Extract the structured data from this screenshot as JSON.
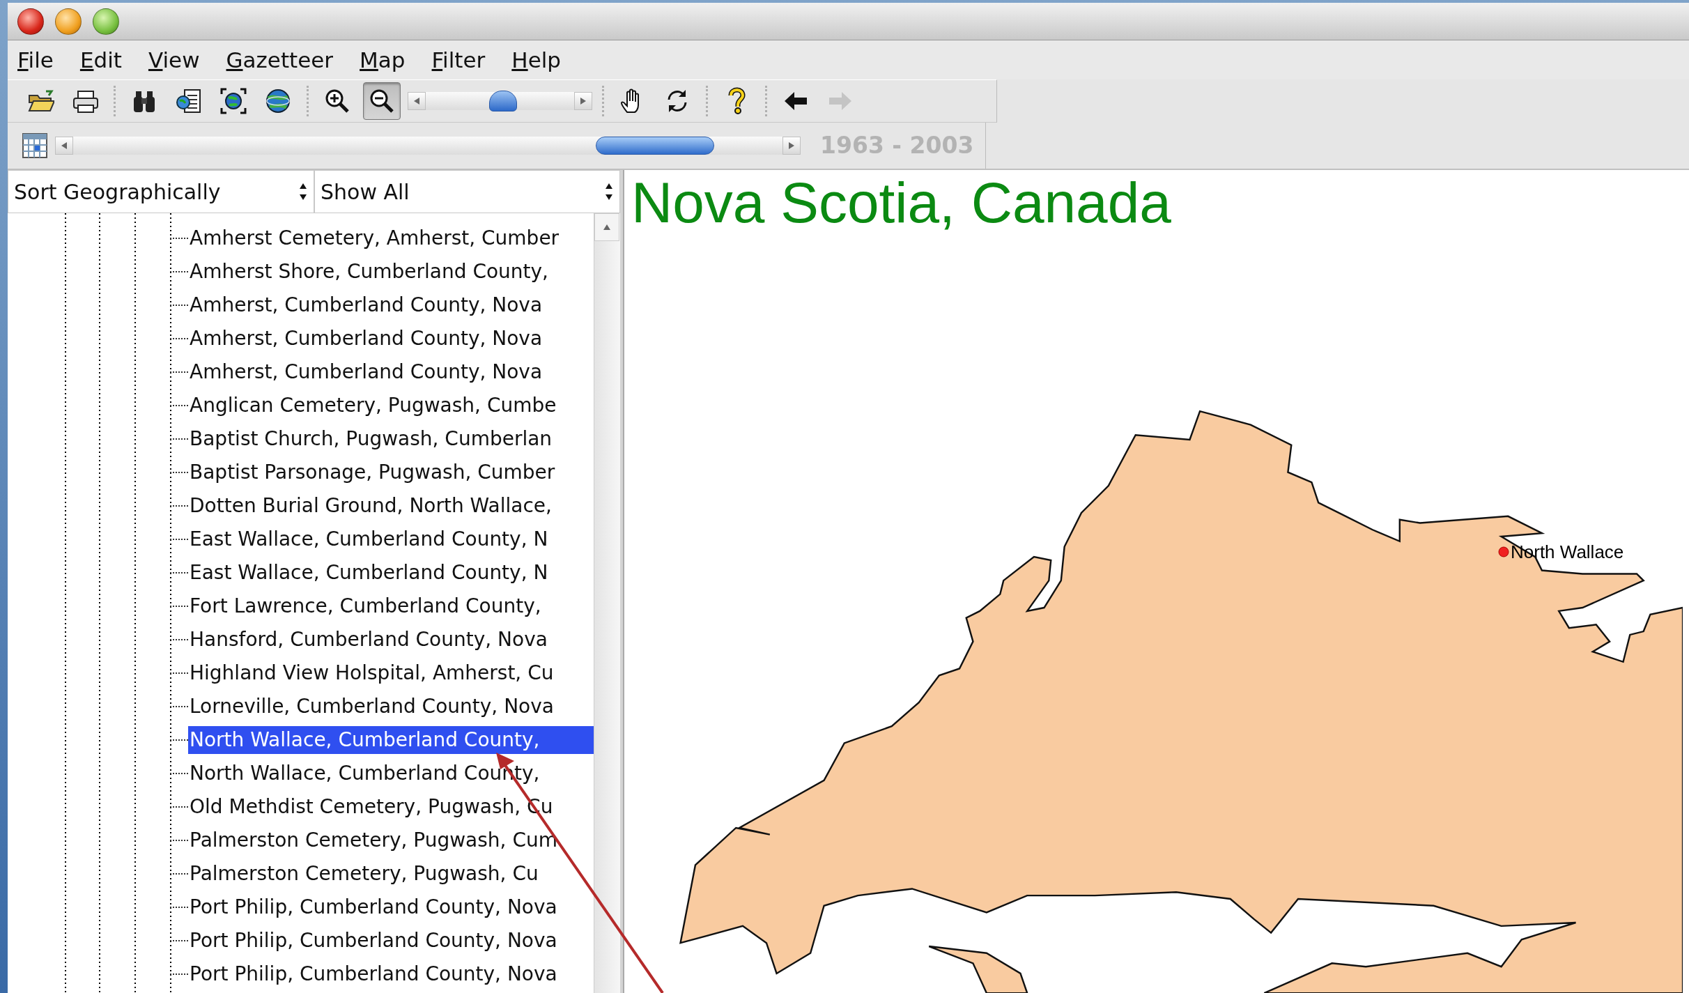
{
  "window": {
    "controls": [
      {
        "kind": "close"
      },
      {
        "kind": "minimize"
      },
      {
        "kind": "zoom"
      }
    ]
  },
  "menu": [
    "File",
    "Edit",
    "View",
    "Gazetteer",
    "Map",
    "Filter",
    "Help"
  ],
  "toolbar": [
    {
      "kind": "open",
      "pressed": false,
      "disabled": false
    },
    {
      "kind": "print",
      "pressed": false,
      "disabled": false
    },
    {
      "kind": "separator"
    },
    {
      "kind": "find",
      "pressed": false,
      "disabled": false
    },
    {
      "kind": "document",
      "pressed": false,
      "disabled": false
    },
    {
      "kind": "extent",
      "pressed": false,
      "disabled": false
    },
    {
      "kind": "globe",
      "pressed": false,
      "disabled": false
    },
    {
      "kind": "separator"
    },
    {
      "kind": "zoom-in",
      "pressed": false,
      "disabled": false
    },
    {
      "kind": "zoom-out",
      "pressed": true,
      "disabled": false
    },
    {
      "kind": "slider",
      "level": 0.52
    },
    {
      "kind": "separator"
    },
    {
      "kind": "pan",
      "pressed": false,
      "disabled": false
    },
    {
      "kind": "refresh",
      "pressed": false,
      "disabled": false
    },
    {
      "kind": "separator"
    },
    {
      "kind": "help",
      "pressed": false,
      "disabled": false
    },
    {
      "kind": "separator"
    },
    {
      "kind": "back",
      "pressed": false,
      "disabled": false
    },
    {
      "kind": "forward",
      "pressed": false,
      "disabled": true
    }
  ],
  "time_bar": {
    "level": 0.82,
    "range": "1963 - 2003"
  },
  "sort_select": {
    "value": "Sort Geographically"
  },
  "filter_select": {
    "value": "Show All"
  },
  "tree": {
    "items": [
      {
        "label": "Amherst Cemetery, Amherst, Cumber",
        "selected": false
      },
      {
        "label": "Amherst Shore, Cumberland County,",
        "selected": false
      },
      {
        "label": "Amherst, Cumberland County, Nova",
        "selected": false
      },
      {
        "label": "Amherst, Cumberland County, Nova",
        "selected": false
      },
      {
        "label": "Amherst, Cumberland County, Nova",
        "selected": false
      },
      {
        "label": "Anglican Cemetery, Pugwash, Cumbe",
        "selected": false
      },
      {
        "label": "Baptist Church, Pugwash, Cumberlan",
        "selected": false
      },
      {
        "label": "Baptist Parsonage, Pugwash, Cumber",
        "selected": false
      },
      {
        "label": "Dotten Burial Ground, North Wallace,",
        "selected": false
      },
      {
        "label": "East Wallace, Cumberland County, N",
        "selected": false
      },
      {
        "label": "East Wallace, Cumberland County, N",
        "selected": false
      },
      {
        "label": "Fort Lawrence, Cumberland County,",
        "selected": false
      },
      {
        "label": "Hansford, Cumberland County, Nova",
        "selected": false
      },
      {
        "label": "Highland View Holspital, Amherst, Cu",
        "selected": false
      },
      {
        "label": "Lorneville, Cumberland County, Nova",
        "selected": false
      },
      {
        "label": "North Wallace, Cumberland County,",
        "selected": true
      },
      {
        "label": "North Wallace, Cumberland County,",
        "selected": false
      },
      {
        "label": "Old Methdist Cemetery, Pugwash, Cu",
        "selected": false
      },
      {
        "label": "Palmerston Cemetery, Pugwash, Cum",
        "selected": false
      },
      {
        "label": "Palmerston Cemetery, Pugwash, Cu",
        "selected": false
      },
      {
        "label": "Port Philip, Cumberland County, Nova",
        "selected": false
      },
      {
        "label": "Port Philip, Cumberland County, Nova",
        "selected": false
      },
      {
        "label": "Port Philip, Cumberland County, Nova",
        "selected": false
      }
    ]
  },
  "map": {
    "title": "Nova Scotia, Canada",
    "places": [
      {
        "label": "North Wallace"
      }
    ]
  }
}
